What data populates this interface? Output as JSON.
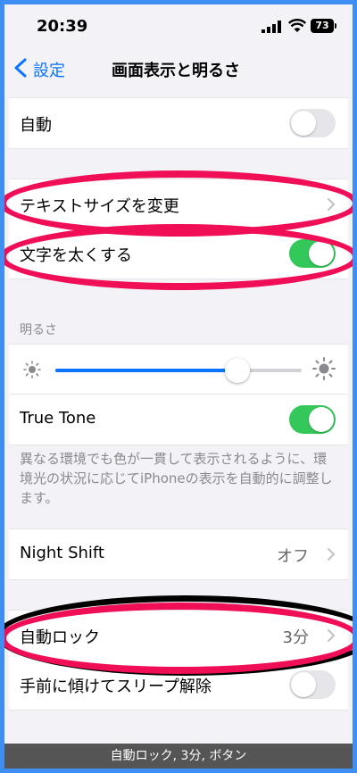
{
  "status": {
    "time": "20:39",
    "battery": "73"
  },
  "nav": {
    "back_label": "設定",
    "title": "画面表示と明るさ"
  },
  "rows": {
    "auto": {
      "label": "自動",
      "toggle": "off"
    },
    "text_size": {
      "label": "テキストサイズを変更"
    },
    "bold_text": {
      "label": "文字を太くする",
      "toggle": "on"
    },
    "true_tone": {
      "label": "True Tone",
      "toggle": "on"
    },
    "night_shift": {
      "label": "Night Shift",
      "value": "オフ"
    },
    "auto_lock": {
      "label": "自動ロック",
      "value": "3分"
    },
    "raise_to_wake": {
      "label": "手前に傾けてスリープ解除",
      "toggle": "off"
    }
  },
  "brightness": {
    "section_label": "明るさ",
    "level": 0.74
  },
  "true_tone_description": "異なる環境でも色が一貫して表示されるように、環境光の状況に応じてiPhoneの表示を自動的に調整します。",
  "accessibility_caption": "自動ロック, 3分, ボタン",
  "colors": {
    "accent": "#0a74ff",
    "toggle_on": "#34c759",
    "highlight": "#f00f56"
  }
}
